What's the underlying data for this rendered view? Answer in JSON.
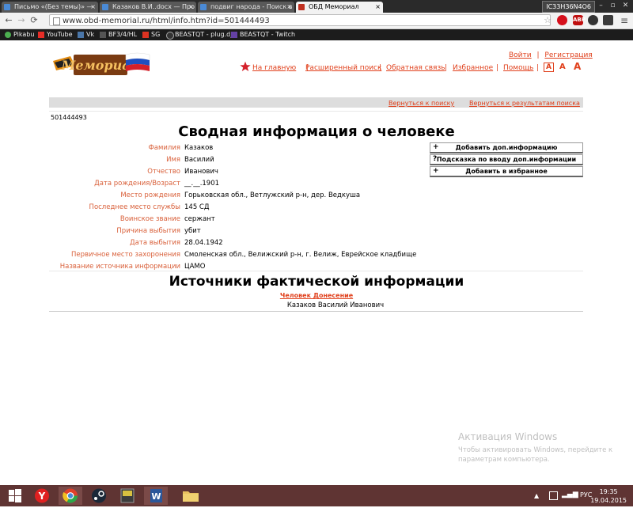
{
  "browser": {
    "tabs": [
      {
        "title": "Письмо «(Без темы)» — ",
        "color": "#4a8ad6"
      },
      {
        "title": "Казаков В.И..docx — Про",
        "color": "#4a8ad6"
      },
      {
        "title": "подвиг народа - Поиск в",
        "color": "#4a8ad6"
      },
      {
        "title": "ОБД Мемориал",
        "color": "#c03020"
      }
    ],
    "profile": "IC33H36N4O6",
    "url": "www.obd-memorial.ru/html/info.htm?id=501444493",
    "bookmarks": [
      "Pikabu",
      "YouTube",
      "Vk",
      "BF3/4/HL",
      "SG",
      "BEASTQT - plug.dj",
      "BEASTQT - Twitch"
    ],
    "ext_labels": [
      "",
      "ABP",
      "",
      ""
    ]
  },
  "header": {
    "logo_text": "Мемориал",
    "login": "Войти",
    "separator": "|",
    "register": "Регистрация",
    "nav": [
      "На главную",
      "Расширенный поиск",
      "Обратная связь",
      "Избранное",
      "Помощь"
    ],
    "font_sizes": [
      "A",
      "A",
      "A"
    ]
  },
  "backlinks": {
    "to_search": "Вернуться к поиску",
    "to_results": "Вернуться к результатам поиска"
  },
  "record": {
    "id": "501444493",
    "title": "Сводная информация о человеке",
    "fields": [
      {
        "label": "Фамилия",
        "value": "Казаков"
      },
      {
        "label": "Имя",
        "value": "Василий"
      },
      {
        "label": "Отчество",
        "value": "Иванович"
      },
      {
        "label": "Дата рождения/Возраст",
        "value": "__.__.1901"
      },
      {
        "label": "Место рождения",
        "value": "Горьковская обл., Ветлужский р-н, дер. Ведкуша"
      },
      {
        "label": "Последнее место службы",
        "value": "145 СД"
      },
      {
        "label": "Воинское звание",
        "value": "сержант"
      },
      {
        "label": "Причина выбытия",
        "value": "убит"
      },
      {
        "label": "Дата выбытия",
        "value": "28.04.1942"
      },
      {
        "label": "Первичное место захоронения",
        "value": "Смоленская обл., Велижский р-н, г. Велиж, Еврейское кладбище"
      },
      {
        "label": "Название источника информации",
        "value": "ЦАМО"
      }
    ],
    "actions": [
      {
        "icon": "+",
        "label": "Добавить доп.информацию"
      },
      {
        "icon": "?",
        "label": "Подсказка по вводу доп.информации"
      },
      {
        "icon": "+",
        "label": "Добавить в избранное"
      }
    ]
  },
  "sources": {
    "title": "Источники фактической информации",
    "link": "Человек Донесение",
    "name": "Казаков Василий Иванович"
  },
  "watermark": {
    "title": "Активация Windows",
    "text": "Чтобы активировать Windows, перейдите к параметрам компьютера."
  },
  "taskbar": {
    "lang": "РУС",
    "time": "19:35",
    "date": "19.04.2015"
  }
}
